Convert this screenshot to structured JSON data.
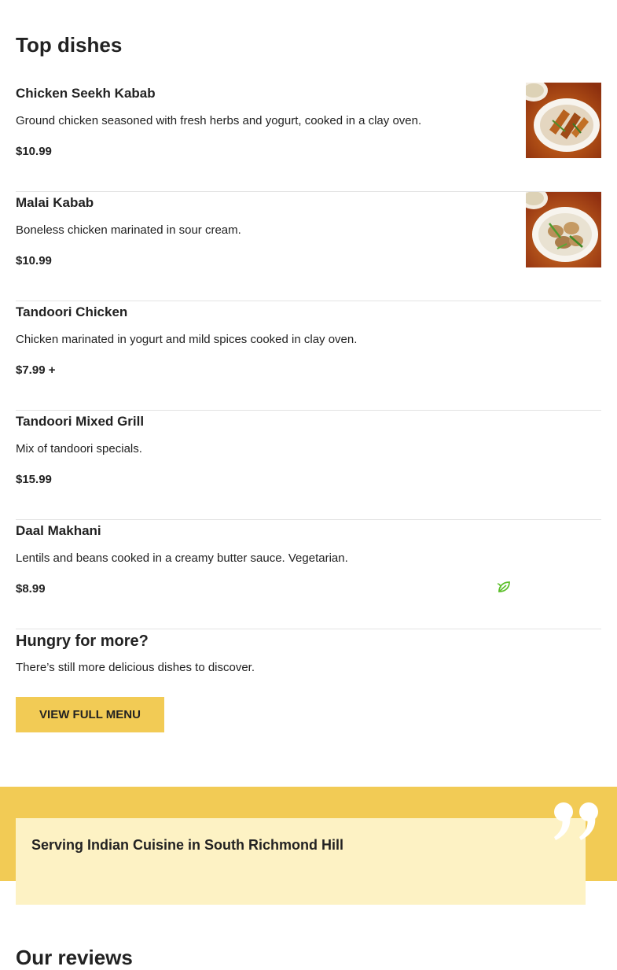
{
  "section": {
    "title": "Top dishes"
  },
  "dishes": [
    {
      "name": "Chicken Seekh Kabab",
      "description": "Ground chicken seasoned with fresh herbs and yogurt, cooked in a clay oven.",
      "price": "$10.99",
      "image": "chicken-seekh-kabab-photo"
    },
    {
      "name": "Malai Kabab",
      "description": "Boneless chicken marinated in sour cream.",
      "price": "$10.99",
      "image": "malai-kabab-photo"
    },
    {
      "name": "Tandoori Chicken",
      "description": "Chicken marinated in yogurt and mild spices cooked in clay oven.",
      "price": "$7.99 +"
    },
    {
      "name": "Tandoori Mixed Grill",
      "description": "Mix of tandoori specials.",
      "price": "$15.99"
    },
    {
      "name": "Daal Makhani",
      "description": "Lentils and beans cooked in a creamy butter sauce. Vegetarian.",
      "price": "$8.99",
      "badge_icon": "vegetarian-leaf-icon"
    }
  ],
  "more": {
    "title": "Hungry for more?",
    "text": "There’s still more delicious dishes to discover.",
    "button_label": "VIEW FULL MENU"
  },
  "banner": {
    "text": "Serving Indian Cuisine in South Richmond Hill",
    "icon": "quote-mark-icon"
  },
  "reviews": {
    "title": "Our reviews"
  },
  "colors": {
    "accent": "#f2cb55",
    "card": "#fdf2c4",
    "veg": "#5cbf2a",
    "text": "#222222"
  }
}
